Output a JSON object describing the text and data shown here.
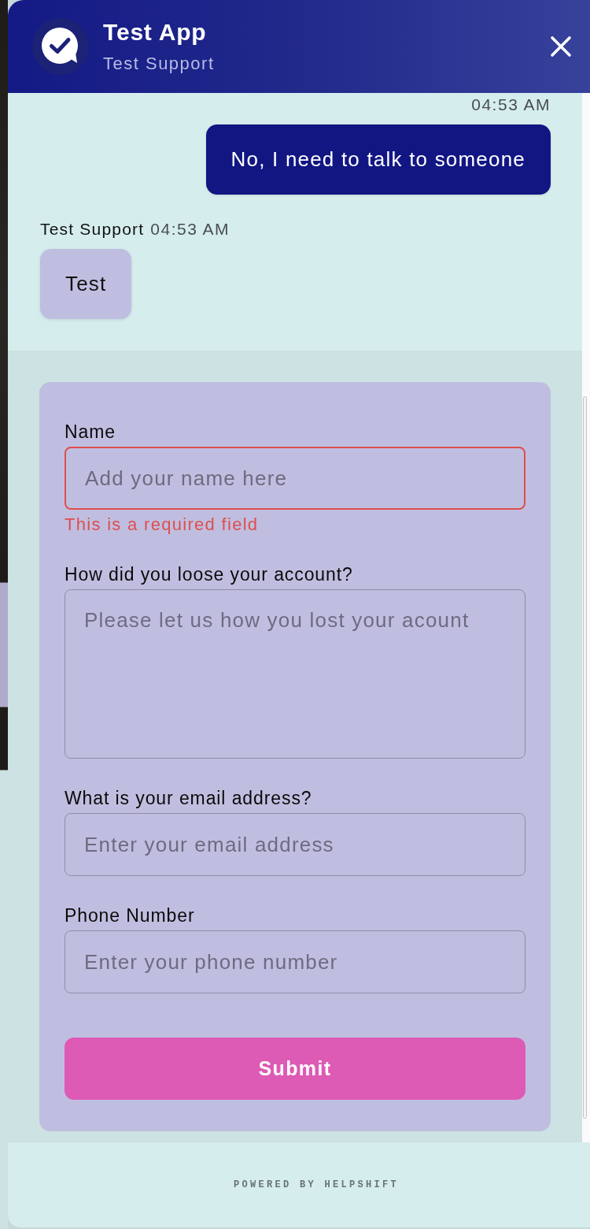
{
  "header": {
    "title": "Test App",
    "subtitle": "Test Support"
  },
  "messages": [
    {
      "kind": "outgoing",
      "time": "04:53 AM",
      "text": "No, I need to talk to someone"
    },
    {
      "kind": "incoming",
      "sender": "Test Support",
      "time": "04:53 AM",
      "text": "Test"
    }
  ],
  "form": {
    "fields": [
      {
        "kind": "input",
        "label": "Name",
        "placeholder": "Add your name here",
        "invalid": true,
        "error": "This is a required field"
      },
      {
        "kind": "textarea",
        "label": "How did you loose your account?",
        "placeholder": "Please let us how you lost your acount",
        "invalid": false
      },
      {
        "kind": "input",
        "label": "What is your email address?",
        "placeholder": "Enter your email address",
        "invalid": false
      },
      {
        "kind": "input",
        "label": "Phone Number",
        "placeholder": "Enter your phone number",
        "invalid": false
      }
    ],
    "submit": "Submit"
  },
  "footer": {
    "text": "POWERED BY HELPSHIFT"
  }
}
